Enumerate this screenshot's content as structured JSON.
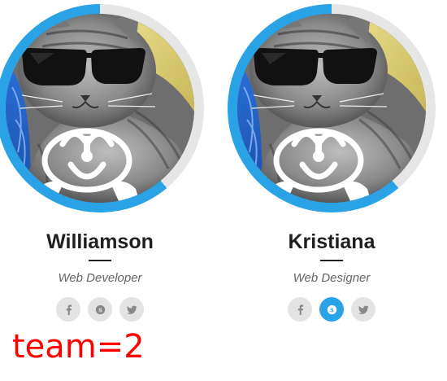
{
  "team": {
    "members": [
      {
        "name": "Williamson",
        "role": "Web Developer",
        "social": [
          {
            "icon": "facebook-icon",
            "active": false
          },
          {
            "icon": "skype-icon",
            "active": false
          },
          {
            "icon": "twitter-icon",
            "active": false
          }
        ]
      },
      {
        "name": "Kristiana",
        "role": "Web Designer",
        "social": [
          {
            "icon": "facebook-icon",
            "active": false
          },
          {
            "icon": "skype-icon",
            "active": true
          },
          {
            "icon": "twitter-icon",
            "active": false
          }
        ]
      }
    ]
  },
  "debug_label": "team=2",
  "colors": {
    "accent": "#2aa3e6",
    "ring_inactive": "#e6e6e6",
    "social_bg": "#e3e3e3",
    "name": "#1f1f1f",
    "role": "#666666",
    "debug_label": "#ff0000"
  }
}
